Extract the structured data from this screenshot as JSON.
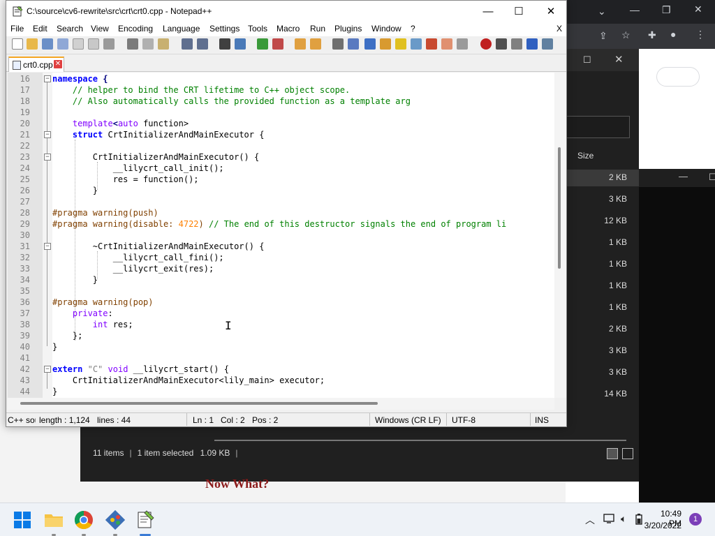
{
  "colors": {
    "accent": "#f5a623",
    "keyword": "#0000ff",
    "comment": "#008000",
    "preprocessor": "#804000",
    "type_keyword": "#8000ff",
    "number": "#ff8000"
  },
  "notepad": {
    "title": "C:\\source\\cv6-rewrite\\src\\crt\\crt0.cpp - Notepad++",
    "menu": [
      "File",
      "Edit",
      "Search",
      "View",
      "Encoding",
      "Language",
      "Settings",
      "Tools",
      "Macro",
      "Run",
      "Plugins",
      "Window",
      "?"
    ],
    "menu_close": "X",
    "tab": {
      "label": "crt0.cpp",
      "close": "✕"
    },
    "status": {
      "language": "C++ sou",
      "length": "length : 1,124",
      "lines": "lines : 44",
      "ln": "Ln : 1",
      "col": "Col : 2",
      "pos": "Pos : 2",
      "eol": "Windows (CR LF)",
      "encoding": "UTF-8",
      "mode": "INS"
    },
    "line_numbers": [
      "16",
      "17",
      "18",
      "19",
      "20",
      "21",
      "22",
      "23",
      "24",
      "25",
      "26",
      "27",
      "28",
      "29",
      "30",
      "31",
      "32",
      "33",
      "34",
      "35",
      "36",
      "37",
      "38",
      "39",
      "40",
      "41",
      "42",
      "43",
      "44"
    ],
    "code": {
      "l16_kw": "namespace",
      "l16_rest": " {",
      "l17": "    // helper to bind the CRT lifetime to C++ object scope.",
      "l18": "    // Also automatically calls the provided function as a template arg",
      "l20_kw": "template",
      "l20_a": "<",
      "l20_auto": "auto",
      "l20_rest": " function>",
      "l21_kw": "struct",
      "l21_rest": " CrtInitializerAndMainExecutor {",
      "l23": "        CrtInitializerAndMainExecutor() {",
      "l24": "            __lilycrt_call_init();",
      "l25": "            res = function();",
      "l26": "        }",
      "l28": "#pragma warning(push)",
      "l29_pp": "#pragma warning(disable: ",
      "l29_num": "4722",
      "l29_close": ")",
      "l29_cm": " // The end of this destructor signals the end of program li",
      "l31": "        ~CrtInitializerAndMainExecutor() {",
      "l32": "            __lilycrt_call_fini();",
      "l33": "            __lilycrt_exit(res);",
      "l34": "        }",
      "l36": "#pragma warning(pop)",
      "l37_kw": "private",
      "l37_rest": ":",
      "l38_kw": "int",
      "l38_rest": " res;",
      "l39": "    };",
      "l40": "}",
      "l42_kw": "extern",
      "l42_str": "\"C\"",
      "l42_kw2": "void",
      "l42_rest": " __lilycrt_start() {",
      "l43": "    CrtInitializerAndMainExecutor<lily_main> executor;",
      "l44": "}"
    }
  },
  "explorer": {
    "size_header": "Size",
    "sizes": [
      "2 KB",
      "3 KB",
      "12 KB",
      "1 KB",
      "1 KB",
      "1 KB",
      "1 KB",
      "2 KB",
      "3 KB",
      "3 KB",
      "14 KB"
    ],
    "status_items": "11 items",
    "status_selected": "1 item selected",
    "status_size": "1.09 KB"
  },
  "blog_heading": "Now What?",
  "taskbar": {
    "time": "10:49 PM",
    "date": "3/20/2022",
    "notification_count": "1"
  },
  "icons": [
    "notepad-icon",
    "start-icon",
    "file-explorer-icon",
    "chrome-icon",
    "git-icon",
    "notepadpp-taskbar-icon",
    "wifi-icon",
    "volume-icon",
    "battery-icon"
  ]
}
